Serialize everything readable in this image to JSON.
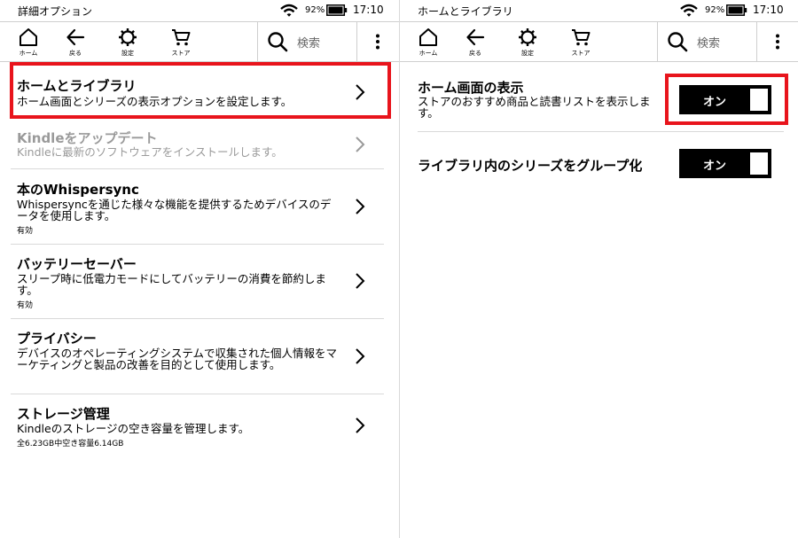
{
  "left": {
    "status": {
      "title": "詳細オプション",
      "battery": "92%",
      "time": "17:10"
    },
    "toolbar": {
      "home": "ホーム",
      "back": "戻る",
      "settings": "設定",
      "store": "ストア",
      "search_placeholder": "検索"
    },
    "items": [
      {
        "title": "ホームとライブラリ",
        "desc": "ホーム画面とシリーズの表示オプションを設定します。",
        "status": ""
      },
      {
        "title": "Kindleをアップデート",
        "desc": "Kindleに最新のソフトウェアをインストールします。",
        "status": ""
      },
      {
        "title": "本のWhispersync",
        "desc": "Whispersyncを通じた様々な機能を提供するためデバイスのデータを使用します。",
        "status": "有効"
      },
      {
        "title": "バッテリーセーバー",
        "desc": "スリープ時に低電力モードにしてバッテリーの消費を節約します。",
        "status": "有効"
      },
      {
        "title": "プライバシー",
        "desc": "デバイスのオペレーティングシステムで収集された個人情報をマーケティングと製品の改善を目的として使用します。",
        "status": ""
      },
      {
        "title": "ストレージ管理",
        "desc": "Kindleのストレージの空き容量を管理します。",
        "status": "全6.23GB中空き容量6.14GB"
      }
    ]
  },
  "right": {
    "status": {
      "title": "ホームとライブラリ",
      "battery": "92%",
      "time": "17:10"
    },
    "toolbar": {
      "home": "ホーム",
      "back": "戻る",
      "settings": "設定",
      "store": "ストア",
      "search_placeholder": "検索"
    },
    "settings": [
      {
        "title": "ホーム画面の表示",
        "desc": "ストアのおすすめ商品と読書リストを表示します。",
        "toggle": "オン"
      },
      {
        "title": "ライブラリ内のシリーズをグループ化",
        "desc": "",
        "toggle": "オン"
      }
    ]
  },
  "colors": {
    "highlight": "#e8141c",
    "toggle_on": "#000000",
    "disabled_text": "#9a9a9a"
  },
  "icons": [
    "wifi-icon",
    "battery-icon",
    "home-icon",
    "back-arrow-icon",
    "gear-icon",
    "cart-icon",
    "search-icon",
    "more-vertical-icon",
    "chevron-right-icon"
  ]
}
